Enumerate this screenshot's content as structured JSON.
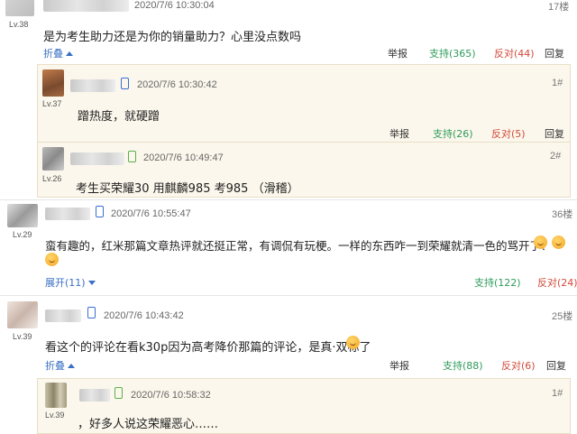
{
  "c1": {
    "level": "Lv.38",
    "time": "2020/7/6 10:30:04",
    "floor": "17楼",
    "text": "是为考生助力还是为你的销量助力？心里没点数吗",
    "toggle": "折叠",
    "report": "举报",
    "support": "支持(365)",
    "oppose": "反对(44)",
    "reply": "回复",
    "replies": [
      {
        "level": "Lv.37",
        "time": "2020/7/6 10:30:42",
        "floor": "1#",
        "text": "蹭热度，就硬蹭",
        "report": "举报",
        "support": "支持(26)",
        "oppose": "反对(5)",
        "reply": "回复"
      },
      {
        "level": "Lv.26",
        "time": "2020/7/6 10:49:47",
        "floor": "2#",
        "text": "考生买荣耀30 用麒麟985 考985 （滑稽）"
      }
    ]
  },
  "c2": {
    "level": "Lv.29",
    "time": "2020/7/6 10:55:47",
    "floor": "36楼",
    "text": "蛮有趣的，红米那篇文章热评就还挺正常，有调侃有玩梗。一样的东西咋一到荣耀就清一色的骂开了？",
    "toggle": "展开(11)",
    "support": "支持(122)",
    "oppose": "反对(24)"
  },
  "c3": {
    "level": "Lv.39",
    "time": "2020/7/6 10:43:42",
    "floor": "25楼",
    "text": "看这个的评论在看k30p因为高考降价那篇的评论，是真·双标了",
    "toggle": "折叠",
    "report": "举报",
    "support": "支持(88)",
    "oppose": "反对(6)",
    "reply": "回复",
    "replies": [
      {
        "level": "Lv.39",
        "time": "2020/7/6 10:58:32",
        "floor": "1#",
        "text": "，好多人说这荣耀恶心……"
      }
    ]
  },
  "colors": {
    "link": "#3a6fc2",
    "support": "#2e9b5a",
    "oppose": "#d24a3a",
    "reply_bg": "#fbf7ec"
  },
  "icons": [
    "mobile-phone-icon",
    "android-phone-icon",
    "emoji-icon",
    "chevron-up-icon",
    "chevron-down-icon"
  ]
}
